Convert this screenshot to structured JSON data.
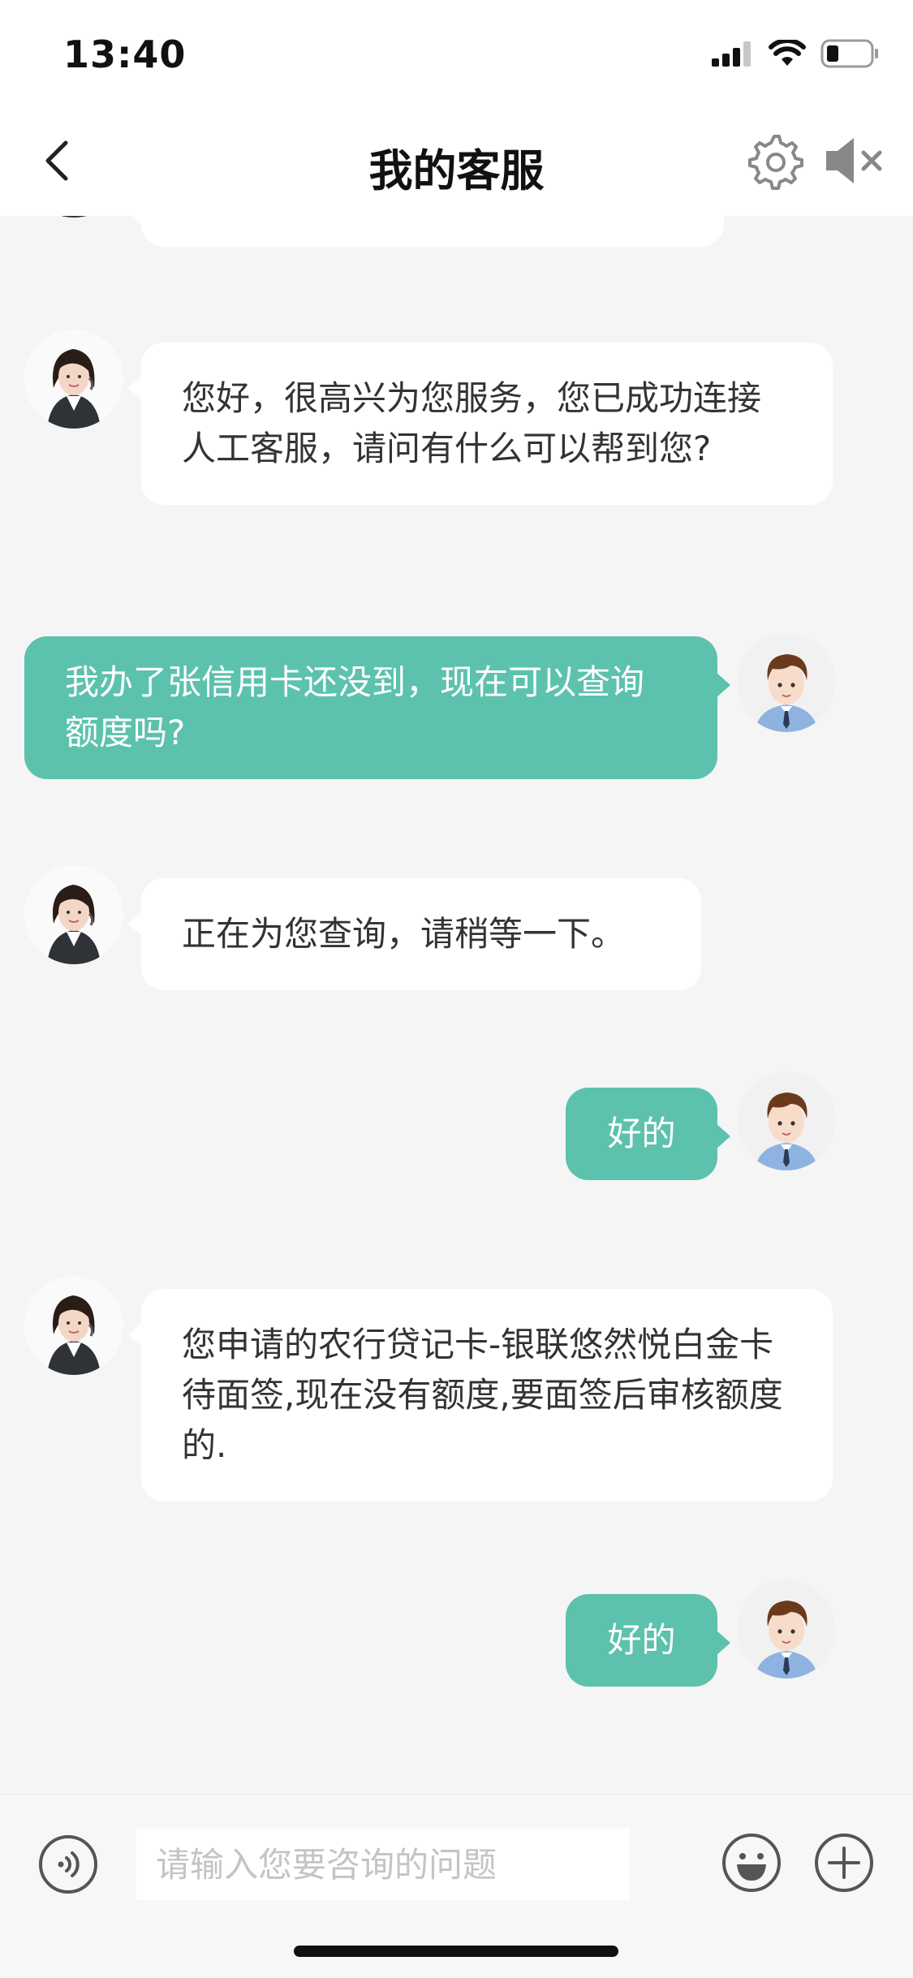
{
  "status_bar": {
    "time": "13:40",
    "icons": [
      "signal-icon",
      "wifi-icon",
      "battery-icon"
    ]
  },
  "header": {
    "title": "我的客服",
    "left_icon": "chevron-left-icon",
    "right_icons": [
      "gear-icon",
      "speaker-muted-icon"
    ]
  },
  "messages": [
    {
      "from": "agent",
      "text": "您好，很高兴为您服务，您已成功连接人工客服，请问有什么可以帮到您?"
    },
    {
      "from": "user",
      "text": "我办了张信用卡还没到，现在可以查询额度吗?"
    },
    {
      "from": "agent",
      "text": "正在为您查询，请稍等一下。"
    },
    {
      "from": "user",
      "text": "好的"
    },
    {
      "from": "agent",
      "text": "您申请的农行贷记卡-银联悠然悦白金卡待面签,现在没有额度,要面签后审核额度的."
    },
    {
      "from": "user",
      "text": "好的"
    }
  ],
  "input_bar": {
    "placeholder": "请输入您要咨询的问题",
    "value": "",
    "icons": [
      "voice-icon",
      "emoji-icon",
      "plus-icon"
    ]
  },
  "colors": {
    "accent": "#5cc2ad",
    "background": "#f5f5f5",
    "agent_bubble": "#ffffff",
    "user_text": "#ffffff"
  }
}
